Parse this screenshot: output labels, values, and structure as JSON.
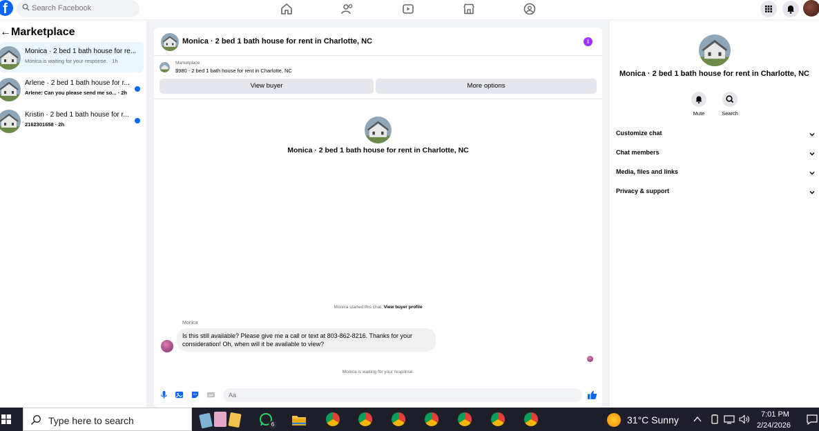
{
  "topbar": {
    "logo": "f",
    "search_placeholder": "Search Facebook",
    "nav": [
      "home-icon",
      "friends-icon",
      "watch-icon",
      "marketplace-icon",
      "groups-icon"
    ],
    "right_icons": [
      "menu-grid-icon",
      "notifications-bell-icon",
      "account-avatar"
    ]
  },
  "left": {
    "back": "←",
    "title": "Marketplace",
    "conversations": [
      {
        "title": "Monica · 2 bed 1 bath house for re...",
        "subtitle": "Monica is waiting for your response. · 1h",
        "unread": false
      },
      {
        "title": "Arlene · 2 bed 1 bath house for r...",
        "subtitle": "Arlene: Can you please send me so... · 2h",
        "unread": true
      },
      {
        "title": "Kristin · 2 bed 1 bath house for r...",
        "subtitle": "2162301658 · 2h",
        "unread": true
      }
    ]
  },
  "chat": {
    "header_title": "Monica · 2 bed 1 bath house for rent in Charlotte, NC",
    "info": "i",
    "marketplace_label": "Marketplace",
    "listing": "$980 - 2 bed 1 bath house for rent in Charlotte, NC",
    "view_buyer": "View buyer",
    "more_options": "More options",
    "center_title": "Monica · 2 bed 1 bath house for rent in Charlotte, NC",
    "started_text": "Monica started this chat.",
    "view_profile": "View buyer profile",
    "sender": "Monica",
    "message": "Is this still available? Please give me a call or text at 803-862-8216. Thanks for your consideration! Oh, when will it be available to view?",
    "waiting": "Monica is waiting for your response.",
    "input_placeholder": "Aa"
  },
  "details": {
    "title": "Monica · 2 bed 1 bath house for rent in Charlotte, NC",
    "mute": "Mute",
    "search": "Search",
    "sections": [
      "Customize chat",
      "Chat members",
      "Media, files and links",
      "Privacy & support"
    ]
  },
  "taskbar": {
    "search_placeholder": "Type here to search",
    "whatsapp_badge": "6",
    "weather": "31°C  Sunny",
    "time": "7:01 PM",
    "date": "2/24/2026"
  },
  "colors": {
    "accent": "#0866ff",
    "info": "#a033ff",
    "taskbar": "#1f1f2b"
  }
}
